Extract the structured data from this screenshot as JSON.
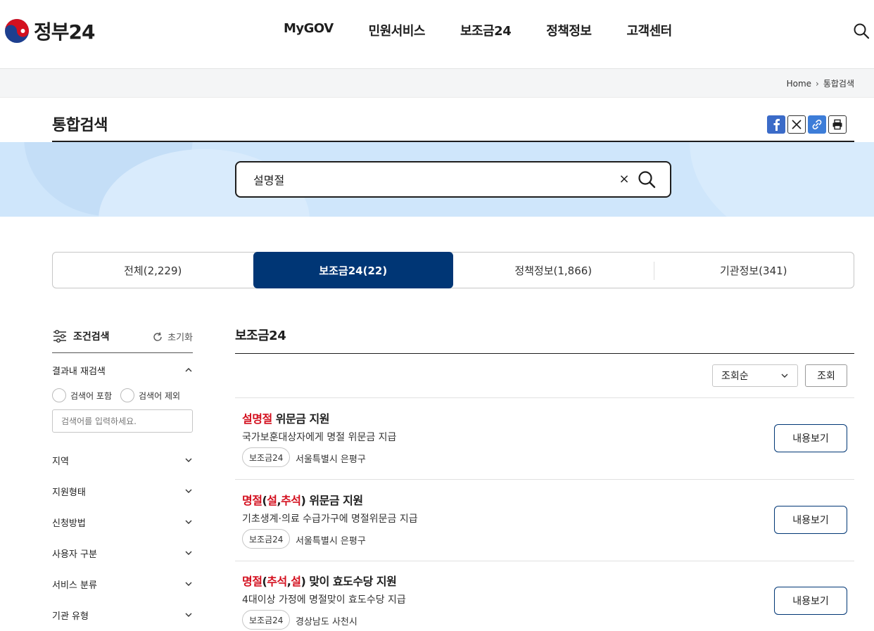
{
  "header": {
    "logo_text": "정부24",
    "nav": [
      "MyGOV",
      "민원서비스",
      "보조금24",
      "정책정보",
      "고객센터"
    ]
  },
  "breadcrumb": {
    "home": "Home",
    "current": "통합검색"
  },
  "page": {
    "title": "통합검색"
  },
  "search": {
    "value": "설명절",
    "clear": "×"
  },
  "tabs": [
    {
      "label": "전체(2,229)",
      "active": false
    },
    {
      "label": "보조금24(22)",
      "active": true
    },
    {
      "label": "정책정보(1,866)",
      "active": false
    },
    {
      "label": "기관정보(341)",
      "active": false
    }
  ],
  "filter": {
    "title": "조건검색",
    "reset": "초기화",
    "research_title": "결과내 재검색",
    "include": "검색어 포함",
    "exclude": "검색어 제외",
    "placeholder": "검색어를 입력하세요.",
    "facets": [
      "지역",
      "지원형태",
      "신청방법",
      "사용자 구분",
      "서비스 분류",
      "기관 유형"
    ]
  },
  "results": {
    "title": "보조금24",
    "sort_value": "조회순",
    "sort_button": "조회",
    "view_label": "내용보기",
    "items": [
      {
        "title_parts": [
          [
            "설명절",
            true
          ],
          [
            " 위문금 지원",
            false
          ]
        ],
        "desc": "국가보훈대상자에게 명절 위문금 지급",
        "tag": "보조금24",
        "location": "서울특별시 은평구"
      },
      {
        "title_parts": [
          [
            "명절",
            true
          ],
          [
            "(",
            false
          ],
          [
            "설",
            true
          ],
          [
            ",",
            false
          ],
          [
            "추석",
            true
          ],
          [
            ") 위문금 지원",
            false
          ]
        ],
        "desc": "기초생계·의료 수급가구에 명절위문금 지급",
        "tag": "보조금24",
        "location": "서울특별시 은평구"
      },
      {
        "title_parts": [
          [
            "명절",
            true
          ],
          [
            "(",
            false
          ],
          [
            "추석",
            true
          ],
          [
            ",",
            false
          ],
          [
            "설",
            true
          ],
          [
            ") 맞이 효도수당 지원",
            false
          ]
        ],
        "desc": "4대이상 가정에 명절맞이 효도수당 지급",
        "tag": "보조금24",
        "location": "경상남도 사천시"
      }
    ]
  },
  "colors": {
    "primary": "#003675",
    "highlight": "#d4101f",
    "band": "#cfe6fb"
  }
}
